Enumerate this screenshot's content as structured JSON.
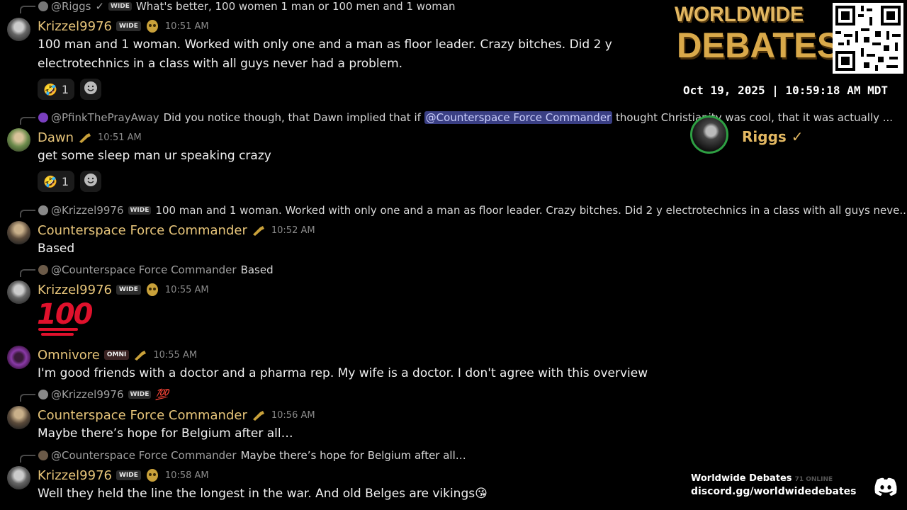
{
  "messages": [
    {
      "reply": {
        "author": "@Riggs",
        "verified": "✓",
        "badge": "WIDE",
        "text": "What's better, 100 women 1 man or 100 men and 1 woman"
      },
      "author": "Krizzel9976",
      "badge": "WIDE",
      "time": "10:51 AM",
      "text": "100 man and 1 woman. Worked with only one and a man as floor leader. Crazy bitches. Did 2 y electrotechnics in a class with all guys never had a problem.",
      "reactions": [
        {
          "emoji": "🤣",
          "count": "1"
        }
      ]
    },
    {
      "reply": {
        "author": "@PfinkThePrayAway",
        "text_before": "Did you notice though, that Dawn implied that if",
        "mention": "@Counterspace Force Commander",
        "text_after": "thought Christianity was cool, that it was actually ..."
      },
      "author": "Dawn",
      "time": "10:51 AM",
      "text": "get some sleep man ur speaking crazy",
      "reactions": [
        {
          "emoji": "🤣",
          "count": "1"
        }
      ]
    },
    {
      "reply": {
        "author": "@Krizzel9976",
        "badge": "WIDE",
        "text": "100 man and 1 woman. Worked with only one and a man as floor leader. Crazy bitches. Did 2 y electrotechnics in a class with all guys neve..."
      },
      "author": "Counterspace Force Commander",
      "time": "10:52 AM",
      "text": "Based"
    },
    {
      "reply": {
        "author": "@Counterspace Force Commander",
        "text": "Based"
      },
      "author": "Krizzel9976",
      "badge": "WIDE",
      "time": "10:55 AM",
      "text": "100"
    },
    {
      "author": "Omnivore",
      "badge": "OMNI",
      "time": "10:55 AM",
      "text": "I'm good friends with a doctor and a pharma rep. My wife is a doctor. I don't agree with this overview"
    },
    {
      "reply": {
        "author": "@Krizzel9976",
        "badge": "WIDE",
        "text": "💯"
      },
      "author": "Counterspace Force Commander",
      "time": "10:56 AM",
      "text": "Maybe there’s hope for Belgium after all…"
    },
    {
      "reply": {
        "author": "@Counterspace Force Commander",
        "text": "Maybe there’s hope for Belgium after all…"
      },
      "author": "Krizzel9976",
      "badge": "WIDE",
      "time": "10:58 AM",
      "text": "Well they held the line the longest in the war. And old Belges are vikings😘"
    }
  ],
  "overlay": {
    "logo_line1": "WORLDWIDE",
    "logo_line2": "DEBATES",
    "datetime": "Oct 19, 2025 | 10:59:18 AM MDT",
    "speaker": "Riggs ✓",
    "server_name": "Worldwide Debates",
    "online": "71 ONLINE",
    "invite": "discord.gg/worldwidedebates"
  },
  "colors": {
    "background": "#000000",
    "username": "#e7c57a",
    "mention_bg": "#3a3f84",
    "speaking_ring": "#2ea043",
    "hundred_red": "#e0112c"
  }
}
